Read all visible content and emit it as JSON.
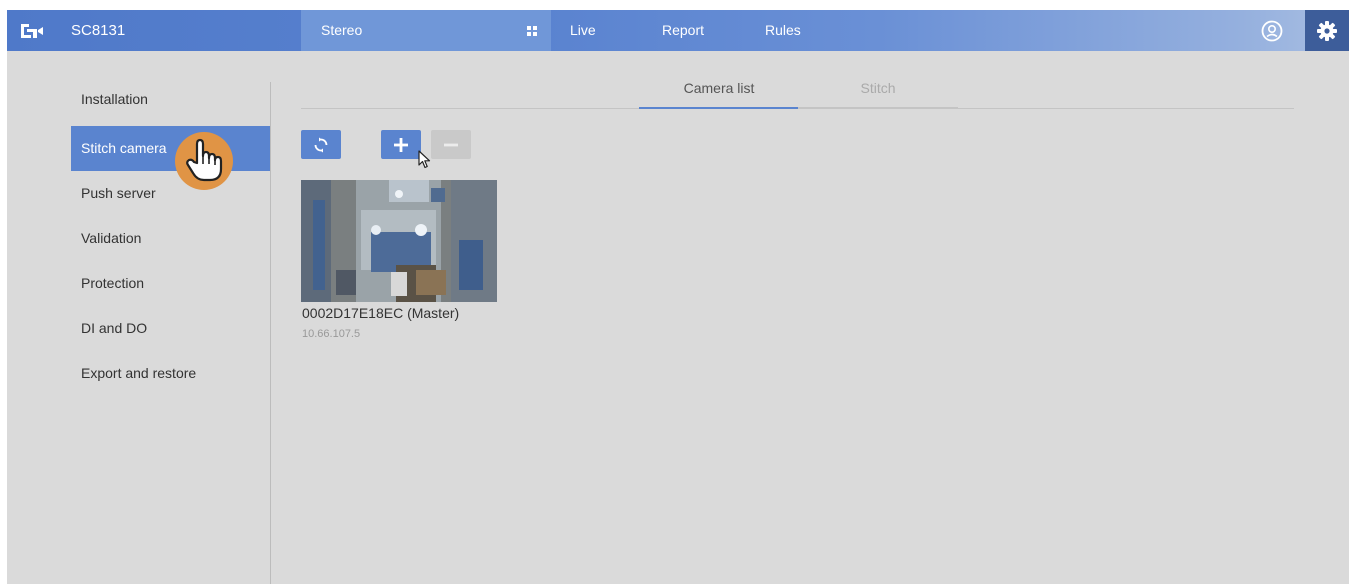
{
  "header": {
    "model": "SC8131",
    "stereo_label": "Stereo",
    "nav": [
      "Live",
      "Report",
      "Rules"
    ],
    "icons": [
      "logo-icon",
      "grid-icon",
      "user-icon",
      "gear-icon"
    ],
    "accent": "#5a84cf"
  },
  "sidebar": {
    "items": [
      {
        "label": "Installation"
      },
      {
        "label": "Stitch camera",
        "active": true
      },
      {
        "label": "Push server"
      },
      {
        "label": "Validation"
      },
      {
        "label": "Protection"
      },
      {
        "label": "DI and DO"
      },
      {
        "label": "Export and restore"
      }
    ]
  },
  "tabs": [
    {
      "label": "Camera list",
      "active": true
    },
    {
      "label": "Stitch",
      "active": false
    }
  ],
  "toolbar": {
    "icons": [
      "refresh-icon",
      "add-icon",
      "remove-icon"
    ],
    "remove_disabled": true
  },
  "camera": {
    "name": "0002D17E18EC (Master)",
    "ip": "10.66.107.5"
  }
}
